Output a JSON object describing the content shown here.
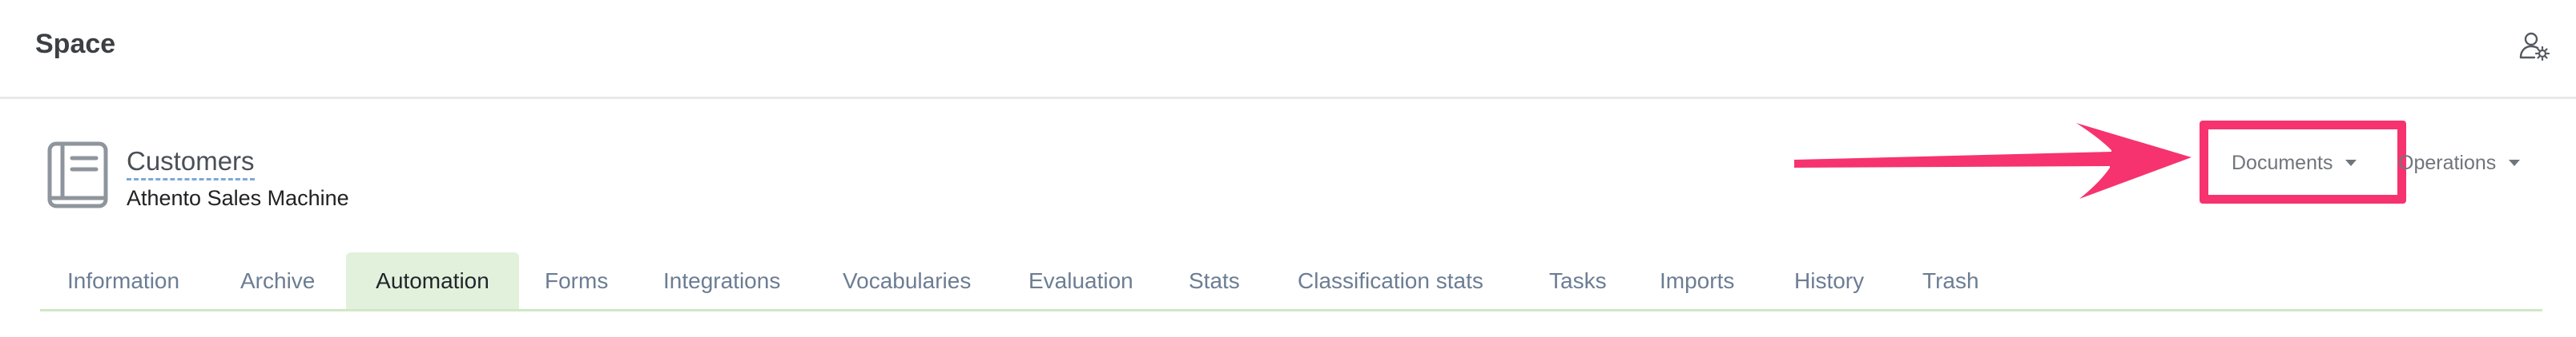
{
  "header": {
    "title": "Space",
    "user_settings_icon": "user-settings-icon"
  },
  "space": {
    "icon": "book-icon",
    "name": "Customers",
    "subtitle": "Athento Sales Machine"
  },
  "actions": {
    "documents_label": "Documents",
    "operations_label": "Operations"
  },
  "annotation": {
    "arrow_color": "#f6336f",
    "highlight_color": "#f6336f"
  },
  "tabs": [
    {
      "label": "Information",
      "active": false
    },
    {
      "label": "Archive",
      "active": false
    },
    {
      "label": "Automation",
      "active": true
    },
    {
      "label": "Forms",
      "active": false
    },
    {
      "label": "Integrations",
      "active": false
    },
    {
      "label": "Vocabularies",
      "active": false
    },
    {
      "label": "Evaluation",
      "active": false
    },
    {
      "label": "Stats",
      "active": false
    },
    {
      "label": "Classification stats",
      "active": false
    },
    {
      "label": "Tasks",
      "active": false
    },
    {
      "label": "Imports",
      "active": false
    },
    {
      "label": "History",
      "active": false
    },
    {
      "label": "Trash",
      "active": false
    }
  ],
  "colors": {
    "active_tab_bg": "#e2f1dc",
    "tab_text": "#6c7d93",
    "tabs_underline": "#cfe8c6"
  }
}
